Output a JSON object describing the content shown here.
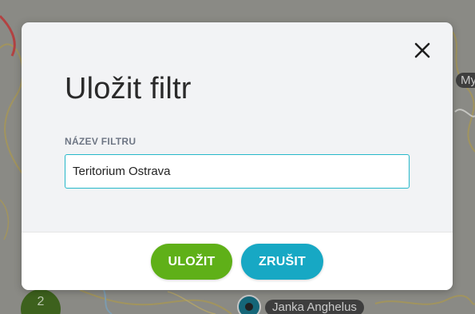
{
  "modal": {
    "title": "Uložit filtr",
    "field_label": "NÁZEV FILTRU",
    "field_value": "Teritorium Ostrava",
    "save_label": "ULOŽIT",
    "cancel_label": "ZRUŠIT",
    "close_icon": "close-icon"
  },
  "map": {
    "label_partial": "My",
    "marker_label": "Janka Anghelus",
    "cluster_count": "2"
  },
  "colors": {
    "accent": "#26b8c9",
    "save": "#5fb018",
    "cancel": "#17a8c4"
  }
}
